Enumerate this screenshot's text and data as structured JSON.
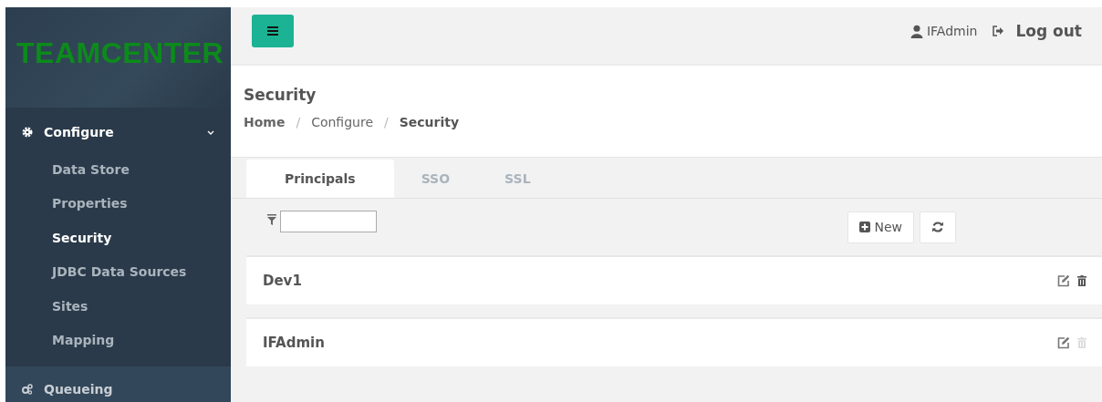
{
  "sidebar": {
    "logo": "TEAMCENTER",
    "sections": [
      {
        "kind": "gear",
        "label": "Configure",
        "expanded": true,
        "items": [
          {
            "label": "Data Store",
            "selected": false
          },
          {
            "label": "Properties",
            "selected": false
          },
          {
            "label": "Security",
            "selected": true
          },
          {
            "label": "JDBC Data Sources",
            "selected": false
          },
          {
            "label": "Sites",
            "selected": false
          },
          {
            "label": "Mapping",
            "selected": false
          }
        ]
      },
      {
        "kind": "gears",
        "label": "Queueing",
        "expanded": false
      }
    ]
  },
  "header": {
    "user": "IFAdmin",
    "logout": "Log out"
  },
  "page": {
    "title": "Security",
    "breadcrumb": [
      {
        "label": "Home",
        "current": false,
        "bold": true
      },
      {
        "separator": "/",
        "label": "Configure",
        "current": false,
        "bold": false
      },
      {
        "separator": "/",
        "label": "Security",
        "current": true,
        "bold": true
      }
    ]
  },
  "tabs": [
    {
      "label": "Principals",
      "selected": true
    },
    {
      "label": "SSO",
      "selected": false
    },
    {
      "label": "SSL",
      "selected": false
    }
  ],
  "toolbar": {
    "new_button": "New"
  },
  "principals": [
    {
      "name": "Dev1",
      "delete_disabled": false
    },
    {
      "name": "IFAdmin",
      "delete_disabled": true
    }
  ]
}
